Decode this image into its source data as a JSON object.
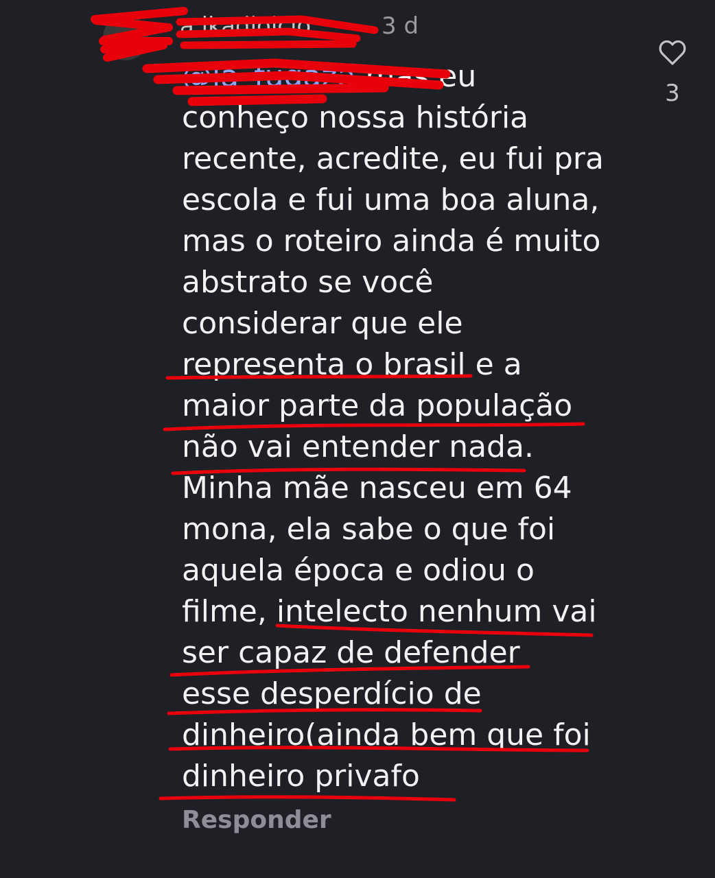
{
  "comment": {
    "username": "a.lkadioicio",
    "timestamp": "3 d",
    "mention": "@la_fugaza",
    "text_lines": [
      "mas eu",
      "conheço nossa história",
      "recente, acredite, eu fui pra",
      "escola e fui uma boa aluna,",
      "mas o roteiro ainda é muito",
      "abstrato se você",
      "considerar que ele",
      "representa o brasil e a",
      "maior parte da população",
      "não vai entender nada.",
      "Minha mãe nasceu em 64",
      "mona, ela sabe o que foi",
      "aquela época e odiou o",
      "filme, intelecto nenhum vai",
      "ser capaz de defender",
      "esse desperdício de",
      "dinheiro(ainda bem que foi",
      "dinheiro privafo"
    ],
    "like_count": "3",
    "reply_label": "Responder"
  },
  "icons": {
    "like": "heart-outline-icon",
    "avatar": "avatar"
  },
  "colors": {
    "background": "#1f2026",
    "text": "#f2f2f2",
    "mention": "#8fa7ff",
    "muted": "#9a9ba1",
    "scribble": "#e8000b"
  }
}
